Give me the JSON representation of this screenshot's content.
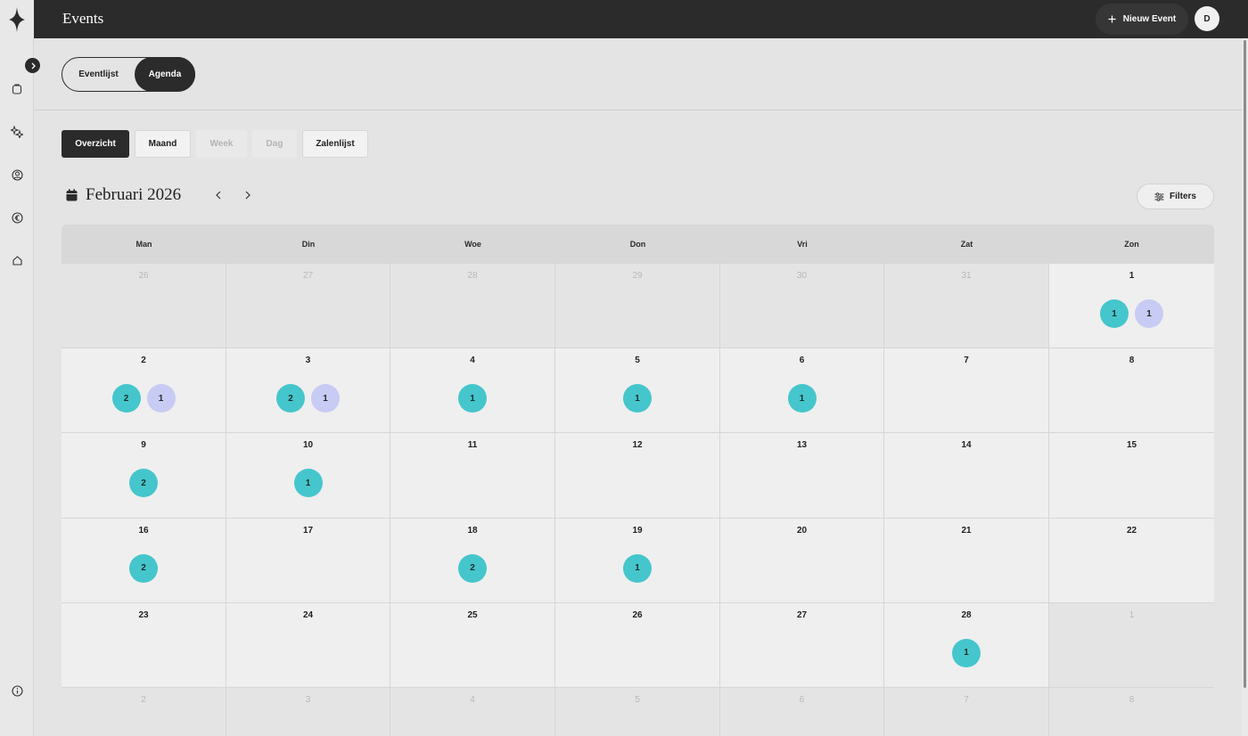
{
  "header": {
    "title": "Events",
    "new_event_label": "Nieuw Event",
    "avatar_initial": "D"
  },
  "sidebar": {
    "icons": [
      "clipboard-icon",
      "sparkle-icon",
      "user-circle-icon",
      "euro-icon",
      "home-icon"
    ],
    "bottom_icon": "info-icon"
  },
  "view_toggle": {
    "list_label": "Eventlijst",
    "agenda_label": "Agenda",
    "active": "Agenda"
  },
  "mode_tabs": [
    {
      "label": "Overzicht",
      "state": "active"
    },
    {
      "label": "Maand",
      "state": "normal"
    },
    {
      "label": "Week",
      "state": "disabled"
    },
    {
      "label": "Dag",
      "state": "disabled"
    },
    {
      "label": "Zalenlijst",
      "state": "normal"
    }
  ],
  "month": {
    "title": "Februari 2026",
    "filters_label": "Filters"
  },
  "colors": {
    "teal_badge": "#45c6cc",
    "lavender_badge": "#c8cbf3",
    "dark": "#2b2b2b"
  },
  "weekdays": [
    "Man",
    "Din",
    "Woe",
    "Don",
    "Vri",
    "Zat",
    "Zon"
  ],
  "weeks": [
    [
      {
        "day": "26",
        "current": false,
        "badges": []
      },
      {
        "day": "27",
        "current": false,
        "badges": []
      },
      {
        "day": "28",
        "current": false,
        "badges": []
      },
      {
        "day": "29",
        "current": false,
        "badges": []
      },
      {
        "day": "30",
        "current": false,
        "badges": []
      },
      {
        "day": "31",
        "current": false,
        "badges": []
      },
      {
        "day": "1",
        "current": true,
        "badges": [
          {
            "count": "1",
            "color": "teal"
          },
          {
            "count": "1",
            "color": "lavender"
          }
        ]
      }
    ],
    [
      {
        "day": "2",
        "current": true,
        "badges": [
          {
            "count": "2",
            "color": "teal"
          },
          {
            "count": "1",
            "color": "lavender"
          }
        ]
      },
      {
        "day": "3",
        "current": true,
        "badges": [
          {
            "count": "2",
            "color": "teal"
          },
          {
            "count": "1",
            "color": "lavender"
          }
        ]
      },
      {
        "day": "4",
        "current": true,
        "badges": [
          {
            "count": "1",
            "color": "teal"
          }
        ]
      },
      {
        "day": "5",
        "current": true,
        "badges": [
          {
            "count": "1",
            "color": "teal"
          }
        ]
      },
      {
        "day": "6",
        "current": true,
        "badges": [
          {
            "count": "1",
            "color": "teal"
          }
        ]
      },
      {
        "day": "7",
        "current": true,
        "badges": []
      },
      {
        "day": "8",
        "current": true,
        "badges": []
      }
    ],
    [
      {
        "day": "9",
        "current": true,
        "badges": [
          {
            "count": "2",
            "color": "teal"
          }
        ]
      },
      {
        "day": "10",
        "current": true,
        "badges": [
          {
            "count": "1",
            "color": "teal"
          }
        ]
      },
      {
        "day": "11",
        "current": true,
        "badges": []
      },
      {
        "day": "12",
        "current": true,
        "badges": []
      },
      {
        "day": "13",
        "current": true,
        "badges": []
      },
      {
        "day": "14",
        "current": true,
        "badges": []
      },
      {
        "day": "15",
        "current": true,
        "badges": []
      }
    ],
    [
      {
        "day": "16",
        "current": true,
        "badges": [
          {
            "count": "2",
            "color": "teal"
          }
        ]
      },
      {
        "day": "17",
        "current": true,
        "badges": []
      },
      {
        "day": "18",
        "current": true,
        "badges": [
          {
            "count": "2",
            "color": "teal"
          }
        ]
      },
      {
        "day": "19",
        "current": true,
        "badges": [
          {
            "count": "1",
            "color": "teal"
          }
        ]
      },
      {
        "day": "20",
        "current": true,
        "badges": []
      },
      {
        "day": "21",
        "current": true,
        "badges": []
      },
      {
        "day": "22",
        "current": true,
        "badges": []
      }
    ],
    [
      {
        "day": "23",
        "current": true,
        "badges": []
      },
      {
        "day": "24",
        "current": true,
        "badges": []
      },
      {
        "day": "25",
        "current": true,
        "badges": []
      },
      {
        "day": "26",
        "current": true,
        "badges": []
      },
      {
        "day": "27",
        "current": true,
        "badges": []
      },
      {
        "day": "28",
        "current": true,
        "badges": [
          {
            "count": "1",
            "color": "teal"
          }
        ]
      },
      {
        "day": "1",
        "current": false,
        "badges": []
      }
    ],
    [
      {
        "day": "2",
        "current": false,
        "badges": []
      },
      {
        "day": "3",
        "current": false,
        "badges": []
      },
      {
        "day": "4",
        "current": false,
        "badges": []
      },
      {
        "day": "5",
        "current": false,
        "badges": []
      },
      {
        "day": "6",
        "current": false,
        "badges": []
      },
      {
        "day": "7",
        "current": false,
        "badges": []
      },
      {
        "day": "8",
        "current": false,
        "badges": []
      }
    ]
  ]
}
